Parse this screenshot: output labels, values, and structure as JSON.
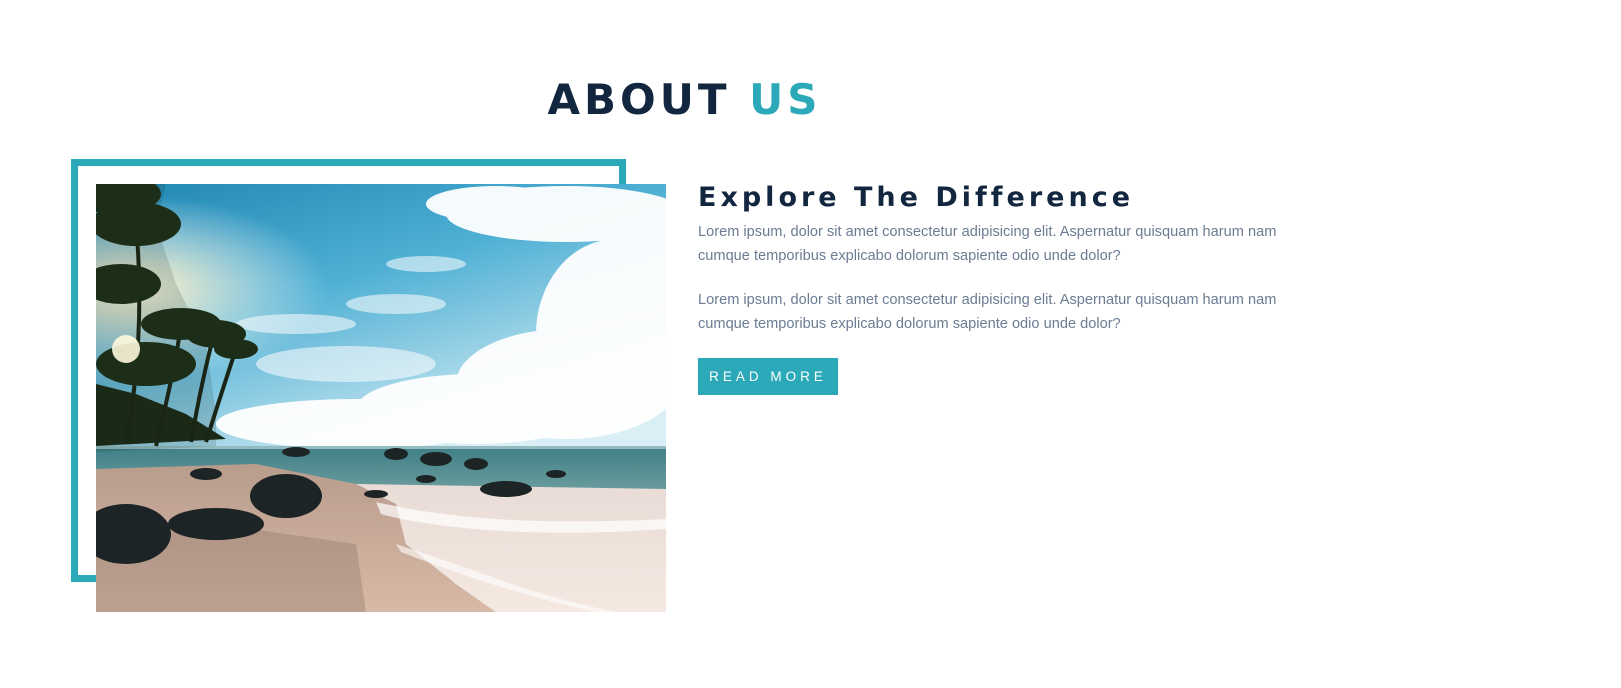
{
  "section": {
    "title_main": "ABOUT",
    "title_accent": "US",
    "accent_color": "#2ba9b8",
    "heading_color": "#12263f"
  },
  "about": {
    "subtitle": "Explore The Difference",
    "paragraph1": "Lorem ipsum, dolor sit amet consectetur adipisicing elit. Aspernatur quisquam harum nam cumque temporibus explicabo dolorum sapiente odio unde dolor?",
    "paragraph2": "Lorem ipsum, dolor sit amet consectetur adipisicing elit. Aspernatur quisquam harum nam cumque temporibus explicabo dolorum sapiente odio unde dolor?",
    "button_label": "READ MORE"
  },
  "image": {
    "subject": "tropical-beach-photo"
  }
}
